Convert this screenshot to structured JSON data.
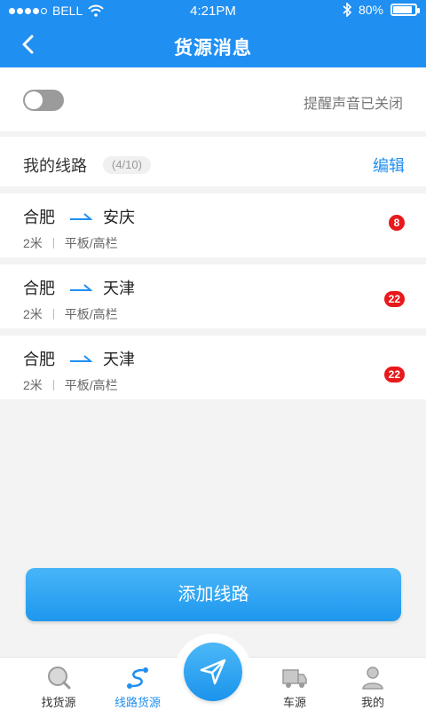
{
  "status_bar": {
    "carrier": "BELL",
    "time": "4:21PM",
    "battery_pct": "80%",
    "signal_bars_filled": 4,
    "signal_bars_total": 5
  },
  "header": {
    "title": "货源消息"
  },
  "sound_setting": {
    "enabled": false,
    "label": "提醒声音已关闭"
  },
  "routes": {
    "title": "我的线路",
    "count": "(4/10)",
    "edit_label": "编辑",
    "items": [
      {
        "from": "合肥",
        "to": "安庆",
        "length": "2米",
        "type": "平板/高栏",
        "badge": "8"
      },
      {
        "from": "合肥",
        "to": "天津",
        "length": "2米",
        "type": "平板/高栏",
        "badge": "22"
      },
      {
        "from": "合肥",
        "to": "天津",
        "length": "2米",
        "type": "平板/高栏",
        "badge": "22"
      }
    ]
  },
  "add_button": {
    "label": "添加线路"
  },
  "tabbar": {
    "tabs": [
      {
        "label": "找货源",
        "icon": "search-goods-icon",
        "active": false
      },
      {
        "label": "线路货源",
        "icon": "route-icon",
        "active": true
      },
      {
        "label": "车源",
        "icon": "truck-icon",
        "active": false
      },
      {
        "label": "我的",
        "icon": "user-icon",
        "active": false
      }
    ],
    "center_icon": "send-icon"
  },
  "colors": {
    "primary": "#1f8ff2",
    "badge": "#e8191c",
    "background": "#f3f3f3"
  }
}
